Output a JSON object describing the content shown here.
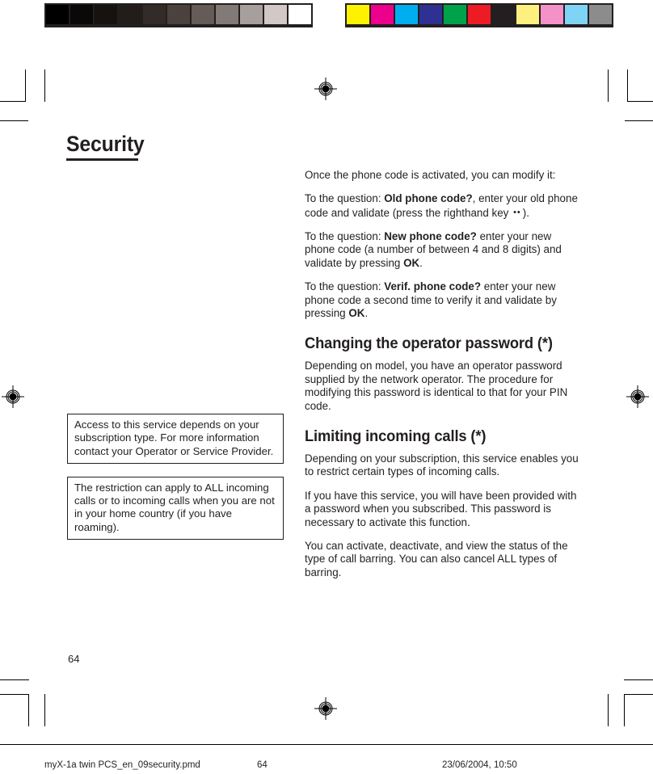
{
  "document": {
    "title": "Security",
    "page_number": "64"
  },
  "calibration": {
    "grey_bar_name": "greyscale-calibration-bar",
    "color_bar_name": "color-calibration-bar",
    "grey_swatches": [
      "#000000",
      "#0b0908",
      "#16120f",
      "#231d19",
      "#332b27",
      "#4b423e",
      "#655b57",
      "#827a76",
      "#a79f9b",
      "#d2c8c6",
      "#ffffff"
    ],
    "color_swatches": [
      "#fff200",
      "#ec008c",
      "#00aeef",
      "#2e3192",
      "#00a14b",
      "#ed1c24",
      "#231f20",
      "#fdf07f",
      "#f492c8",
      "#7fd4f5",
      "#8c8c8c"
    ]
  },
  "left_column": {
    "callouts": [
      "Access to this service depends on your subscription type.  For more information contact your Operator or Service Provider.",
      "The restriction can apply to ALL incoming calls or to incoming calls when you are not in your home country (if you have roaming)."
    ]
  },
  "right_column": {
    "intro": "Once the phone code is activated, you can modify it:",
    "old_code": {
      "lead": "To the question: ",
      "bold": "Old phone code?",
      "tail_1": ", enter your old phone code and validate (press the righthand key ",
      "key_glyph": "••",
      "tail_2": ")."
    },
    "new_code": {
      "lead": "To the question: ",
      "bold": "New phone code?",
      "mid": " enter your new phone code (a number of between 4 and 8 digits) and validate by pressing ",
      "bold_2": "OK",
      "tail": "."
    },
    "verif_code": {
      "lead": "To the question: ",
      "bold": "Verif. phone code?",
      "mid": " enter your new phone code a second time to verify it and validate by pressing ",
      "bold_2": "OK",
      "tail": "."
    },
    "operator_password": {
      "heading": "Changing the operator password (*)",
      "body": "Depending on model, you have an operator password supplied by the network operator. The procedure for modifying this password is identical to that for your PIN code."
    },
    "limiting_calls": {
      "heading": "Limiting incoming calls (*)",
      "para_1": "Depending on your subscription, this service enables you to restrict certain types of incoming calls.",
      "para_2": "If you have this service, you will have been provided with a password when you subscribed. This password is necessary to activate this function.",
      "para_3": "You can activate, deactivate, and view the status of the type of call barring. You can also cancel ALL types of barring."
    }
  },
  "footer": {
    "filename": "myX-1a twin PCS_en_09security.pmd",
    "page": "64",
    "timestamp": "23/06/2004, 10:50"
  }
}
